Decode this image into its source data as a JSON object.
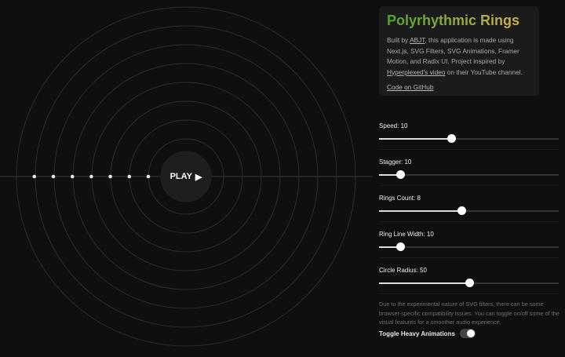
{
  "stage": {
    "play_label": "PLAY",
    "rings_count": 8,
    "dot_count": 7
  },
  "info": {
    "title": "Polyrhythmic Rings",
    "desc_pre": "Built by ",
    "author": "ABJT",
    "desc_mid": ", this application is made using Next.js, SVG Filters, SVG Animations, Framer Motion, and Radix UI. Project inspired by ",
    "video": "Hyperplexed's video",
    "desc_post": " on their YouTube channel.",
    "github": "Code on GitHub"
  },
  "controls": [
    {
      "label": "Speed: 10",
      "percent": 40
    },
    {
      "label": "Stagger: 10",
      "percent": 12
    },
    {
      "label": "Rings Count: 8",
      "percent": 46
    },
    {
      "label": "Ring Line Width: 10",
      "percent": 12
    },
    {
      "label": "Circle Radius: 50",
      "percent": 50
    }
  ],
  "note": "Due to the experimental nature of SVG filters, there can be some browser-specific compatibility issues. You can toggle on/off some of the visual features for a smoother audio experience.",
  "toggle": {
    "label": "Toggle Heavy Animations",
    "on": true
  },
  "colors": {
    "title_start": "#4fa52a",
    "title_end": "#d8b24d"
  }
}
